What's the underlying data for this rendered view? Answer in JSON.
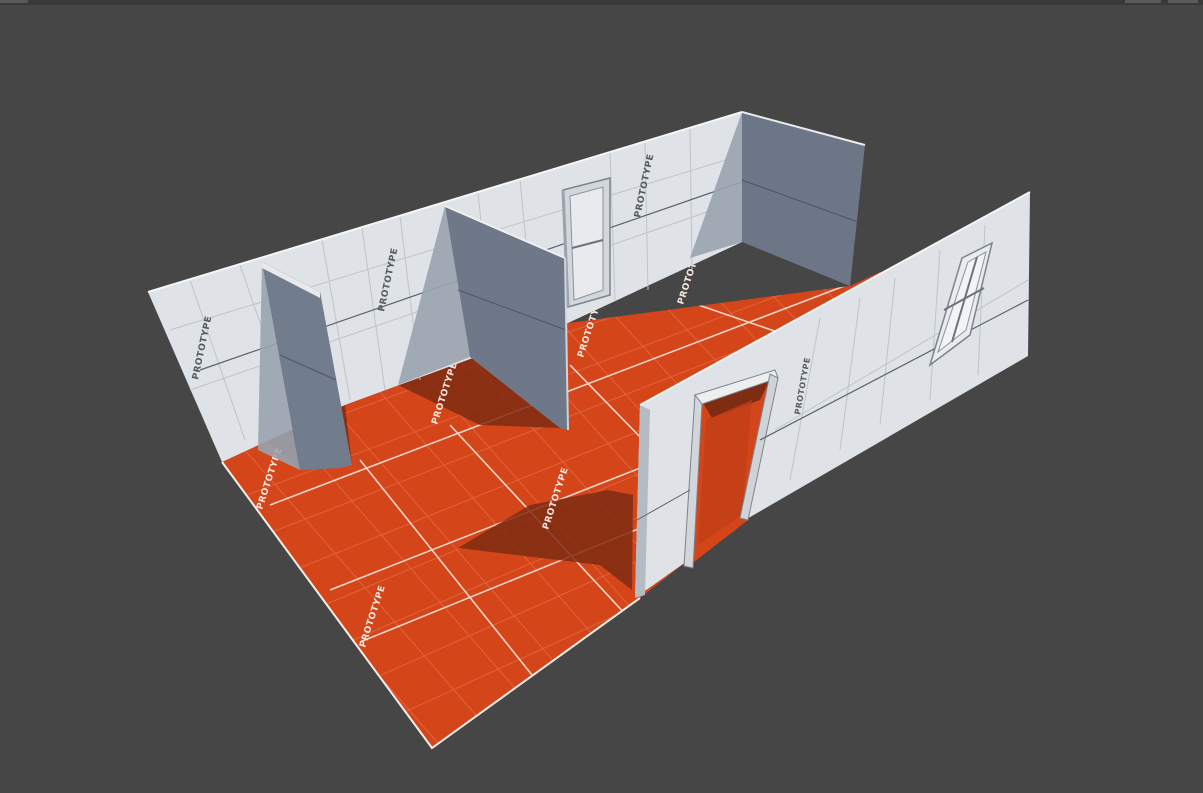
{
  "viewport": {
    "background": "#464646"
  },
  "scene": {
    "floor_color": "#d5451a",
    "floor_grid_color": "#e8754e",
    "floor_major_line_color": "#f2d3c7",
    "floor_shadow_color": "#7a2a12",
    "wall_light_color": "#dcdfe3",
    "wall_shadow_color": "#6b7584",
    "wall_grid_color": "#b9bec6",
    "floor_labels": [
      "PROTOTYPE",
      "PROTOTYPE",
      "PROTOTYPE",
      "PROTOTYPE",
      "PROTOTYPE",
      "PROTOTYPE"
    ],
    "wall_labels": [
      "PROTOTYPE",
      "PROTOTYPE",
      "PROTOTYPE",
      "PROTOTYPE"
    ]
  }
}
